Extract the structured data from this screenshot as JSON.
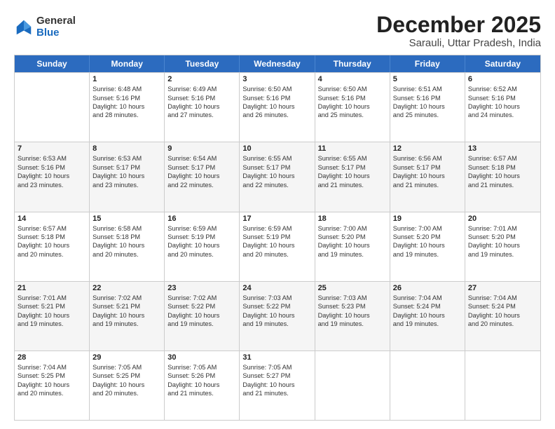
{
  "logo": {
    "general": "General",
    "blue": "Blue"
  },
  "title": "December 2025",
  "subtitle": "Sarauli, Uttar Pradesh, India",
  "header_days": [
    "Sunday",
    "Monday",
    "Tuesday",
    "Wednesday",
    "Thursday",
    "Friday",
    "Saturday"
  ],
  "weeks": [
    [
      {
        "day": "",
        "info": ""
      },
      {
        "day": "1",
        "info": "Sunrise: 6:48 AM\nSunset: 5:16 PM\nDaylight: 10 hours\nand 28 minutes."
      },
      {
        "day": "2",
        "info": "Sunrise: 6:49 AM\nSunset: 5:16 PM\nDaylight: 10 hours\nand 27 minutes."
      },
      {
        "day": "3",
        "info": "Sunrise: 6:50 AM\nSunset: 5:16 PM\nDaylight: 10 hours\nand 26 minutes."
      },
      {
        "day": "4",
        "info": "Sunrise: 6:50 AM\nSunset: 5:16 PM\nDaylight: 10 hours\nand 25 minutes."
      },
      {
        "day": "5",
        "info": "Sunrise: 6:51 AM\nSunset: 5:16 PM\nDaylight: 10 hours\nand 25 minutes."
      },
      {
        "day": "6",
        "info": "Sunrise: 6:52 AM\nSunset: 5:16 PM\nDaylight: 10 hours\nand 24 minutes."
      }
    ],
    [
      {
        "day": "7",
        "info": "Sunrise: 6:53 AM\nSunset: 5:16 PM\nDaylight: 10 hours\nand 23 minutes."
      },
      {
        "day": "8",
        "info": "Sunrise: 6:53 AM\nSunset: 5:17 PM\nDaylight: 10 hours\nand 23 minutes."
      },
      {
        "day": "9",
        "info": "Sunrise: 6:54 AM\nSunset: 5:17 PM\nDaylight: 10 hours\nand 22 minutes."
      },
      {
        "day": "10",
        "info": "Sunrise: 6:55 AM\nSunset: 5:17 PM\nDaylight: 10 hours\nand 22 minutes."
      },
      {
        "day": "11",
        "info": "Sunrise: 6:55 AM\nSunset: 5:17 PM\nDaylight: 10 hours\nand 21 minutes."
      },
      {
        "day": "12",
        "info": "Sunrise: 6:56 AM\nSunset: 5:17 PM\nDaylight: 10 hours\nand 21 minutes."
      },
      {
        "day": "13",
        "info": "Sunrise: 6:57 AM\nSunset: 5:18 PM\nDaylight: 10 hours\nand 21 minutes."
      }
    ],
    [
      {
        "day": "14",
        "info": "Sunrise: 6:57 AM\nSunset: 5:18 PM\nDaylight: 10 hours\nand 20 minutes."
      },
      {
        "day": "15",
        "info": "Sunrise: 6:58 AM\nSunset: 5:18 PM\nDaylight: 10 hours\nand 20 minutes."
      },
      {
        "day": "16",
        "info": "Sunrise: 6:59 AM\nSunset: 5:19 PM\nDaylight: 10 hours\nand 20 minutes."
      },
      {
        "day": "17",
        "info": "Sunrise: 6:59 AM\nSunset: 5:19 PM\nDaylight: 10 hours\nand 20 minutes."
      },
      {
        "day": "18",
        "info": "Sunrise: 7:00 AM\nSunset: 5:20 PM\nDaylight: 10 hours\nand 19 minutes."
      },
      {
        "day": "19",
        "info": "Sunrise: 7:00 AM\nSunset: 5:20 PM\nDaylight: 10 hours\nand 19 minutes."
      },
      {
        "day": "20",
        "info": "Sunrise: 7:01 AM\nSunset: 5:20 PM\nDaylight: 10 hours\nand 19 minutes."
      }
    ],
    [
      {
        "day": "21",
        "info": "Sunrise: 7:01 AM\nSunset: 5:21 PM\nDaylight: 10 hours\nand 19 minutes."
      },
      {
        "day": "22",
        "info": "Sunrise: 7:02 AM\nSunset: 5:21 PM\nDaylight: 10 hours\nand 19 minutes."
      },
      {
        "day": "23",
        "info": "Sunrise: 7:02 AM\nSunset: 5:22 PM\nDaylight: 10 hours\nand 19 minutes."
      },
      {
        "day": "24",
        "info": "Sunrise: 7:03 AM\nSunset: 5:22 PM\nDaylight: 10 hours\nand 19 minutes."
      },
      {
        "day": "25",
        "info": "Sunrise: 7:03 AM\nSunset: 5:23 PM\nDaylight: 10 hours\nand 19 minutes."
      },
      {
        "day": "26",
        "info": "Sunrise: 7:04 AM\nSunset: 5:24 PM\nDaylight: 10 hours\nand 19 minutes."
      },
      {
        "day": "27",
        "info": "Sunrise: 7:04 AM\nSunset: 5:24 PM\nDaylight: 10 hours\nand 20 minutes."
      }
    ],
    [
      {
        "day": "28",
        "info": "Sunrise: 7:04 AM\nSunset: 5:25 PM\nDaylight: 10 hours\nand 20 minutes."
      },
      {
        "day": "29",
        "info": "Sunrise: 7:05 AM\nSunset: 5:25 PM\nDaylight: 10 hours\nand 20 minutes."
      },
      {
        "day": "30",
        "info": "Sunrise: 7:05 AM\nSunset: 5:26 PM\nDaylight: 10 hours\nand 21 minutes."
      },
      {
        "day": "31",
        "info": "Sunrise: 7:05 AM\nSunset: 5:27 PM\nDaylight: 10 hours\nand 21 minutes."
      },
      {
        "day": "",
        "info": ""
      },
      {
        "day": "",
        "info": ""
      },
      {
        "day": "",
        "info": ""
      }
    ]
  ]
}
